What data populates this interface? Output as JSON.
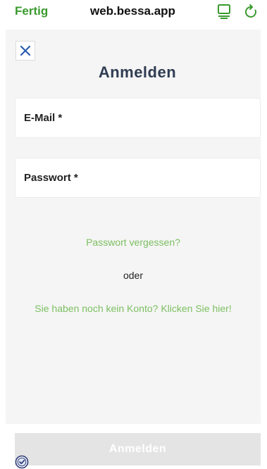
{
  "browser": {
    "done_label": "Fertig",
    "url": "web.bessa.app",
    "reader_icon": "reader-mode-icon",
    "reload_icon": "reload-icon"
  },
  "colors": {
    "accent_green": "#7cc061",
    "done_green": "#3a9a2e",
    "title_dark": "#2f3d52",
    "close_blue": "#2a5db0",
    "page_bg": "#f5f5f5",
    "button_disabled": "#e4e4e4"
  },
  "dialog": {
    "close_icon": "close-icon",
    "title": "Anmelden",
    "email_label": "E-Mail *",
    "password_label": "Passwort *",
    "forgot_link": "Passwort vergessen?",
    "or_text": "oder",
    "register_link": "Sie haben noch kein Konto? Klicken Sie hier!",
    "submit_label": "Anmelden"
  },
  "footer": {
    "badge_icon": "verified-badge-icon"
  }
}
